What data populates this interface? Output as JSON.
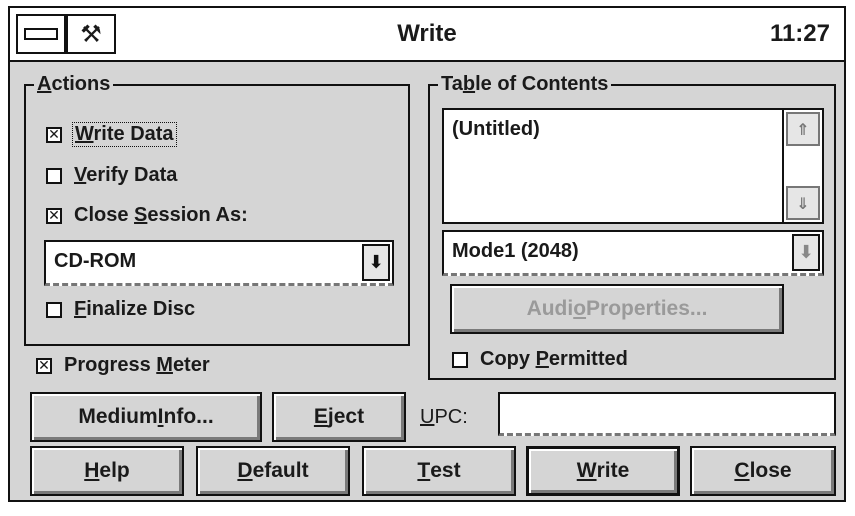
{
  "window": {
    "title": "Write",
    "clock": "11:27"
  },
  "titlebar": {
    "system_menu_icon": "system-menu-icon",
    "tool_icon": "wrench-icon"
  },
  "actions": {
    "label_underlined": "A",
    "label_rest": "ctions",
    "write_data": {
      "pre": "",
      "u": "W",
      "post": "rite Data",
      "checked": true
    },
    "verify_data": {
      "pre": "",
      "u": "V",
      "post": "erify Data",
      "checked": false
    },
    "close_session": {
      "pre": "Close ",
      "u": "S",
      "post": "ession As:",
      "checked": true
    },
    "session_type": {
      "value": "CD-ROM",
      "arrow": "⬇"
    },
    "finalize_disc": {
      "pre": "",
      "u": "F",
      "post": "inalize Disc",
      "checked": false
    }
  },
  "progress_meter": {
    "pre": "Progress ",
    "u": "M",
    "post": "eter",
    "checked": true
  },
  "toc": {
    "label_pre": "Ta",
    "label_u": "b",
    "label_post": "le of Contents",
    "items": [
      "(Untitled)"
    ],
    "scroll_up": "⇑",
    "scroll_down": "⇓",
    "mode": {
      "value": "Mode1 (2048)",
      "arrow": "⬇"
    },
    "audio_properties": {
      "pre": "Audi",
      "u": "o",
      "post": " Properties..."
    },
    "copy_permitted": {
      "pre": "Copy ",
      "u": "P",
      "post": "ermitted",
      "checked": false
    }
  },
  "buttons": {
    "medium_info": {
      "pre": "Medium ",
      "u": "I",
      "post": "nfo..."
    },
    "eject": {
      "pre": "",
      "u": "E",
      "post": "ject"
    },
    "help": {
      "pre": "",
      "u": "H",
      "post": "elp"
    },
    "default": {
      "pre": "",
      "u": "D",
      "post": "efault"
    },
    "test": {
      "pre": "",
      "u": "T",
      "post": "est"
    },
    "write": {
      "pre": "",
      "u": "W",
      "post": "rite"
    },
    "close": {
      "pre": "",
      "u": "C",
      "post": "lose"
    }
  },
  "upc": {
    "label_u": "U",
    "label_post": "PC:",
    "value": ""
  },
  "check_mark": "✕"
}
